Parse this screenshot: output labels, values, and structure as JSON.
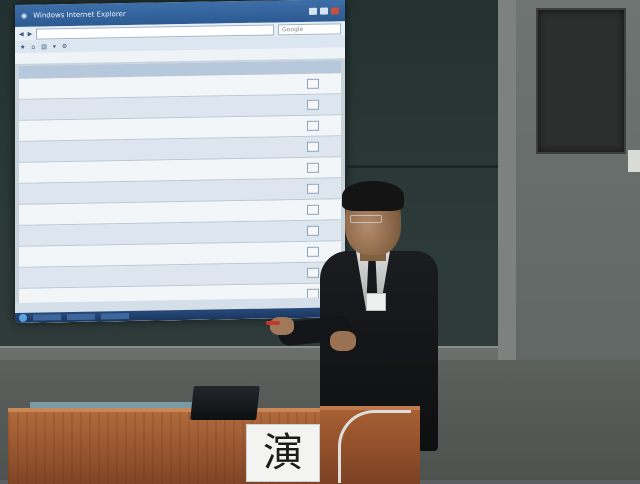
{
  "screen": {
    "window_title": "Windows Internet Explorer",
    "search_placeholder": "Google",
    "address": "",
    "favorites_label": "",
    "status_text": "",
    "clock_text": ""
  },
  "podium_sign": {
    "text": "演"
  },
  "colors": {
    "projected_screen": "#c9d4dc",
    "chalkboard": "#2b3938",
    "podium_wood": "#9a5730",
    "titlebar": "#3e6fa8"
  }
}
